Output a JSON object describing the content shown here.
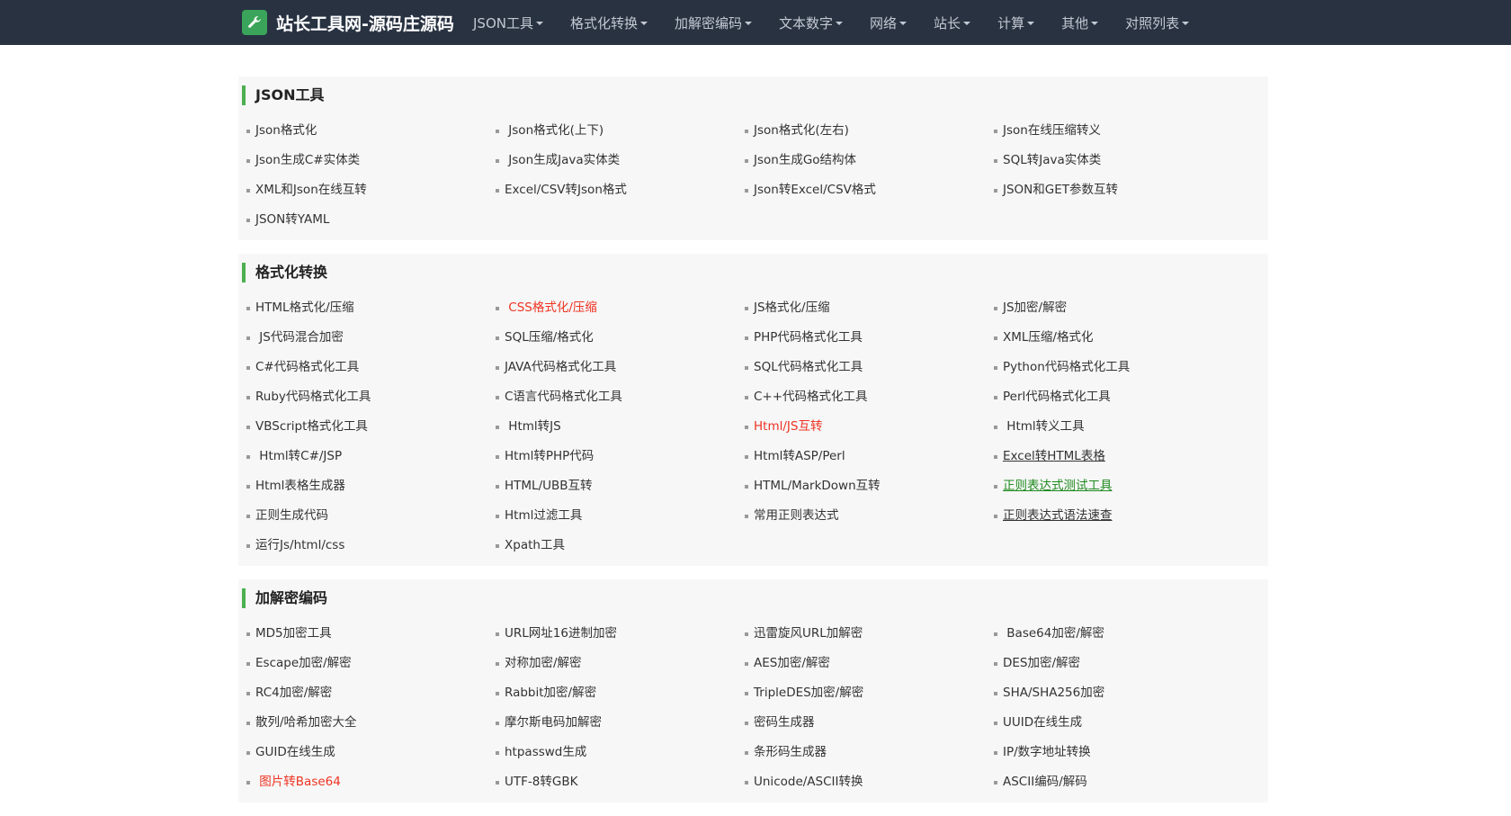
{
  "header": {
    "brand": "站长工具网-源码庄源码",
    "logo_icon": "wrench-icon",
    "menu": [
      {
        "label": "JSON工具"
      },
      {
        "label": "格式化转换"
      },
      {
        "label": "加解密编码"
      },
      {
        "label": "文本数字"
      },
      {
        "label": "网络"
      },
      {
        "label": "站长"
      },
      {
        "label": "计算"
      },
      {
        "label": "其他"
      },
      {
        "label": "对照列表"
      }
    ]
  },
  "colors": {
    "navbar": "#283241",
    "accent": "#4cb050",
    "highlight_red": "#ee3322",
    "highlight_green": "#1f8a1f"
  },
  "sections": [
    {
      "title": "JSON工具",
      "links": [
        {
          "label": "Json格式化"
        },
        {
          "label": " Json格式化(上下)"
        },
        {
          "label": "Json格式化(左右)"
        },
        {
          "label": "Json在线压缩转义"
        },
        {
          "label": "Json生成C#实体类"
        },
        {
          "label": " Json生成Java实体类"
        },
        {
          "label": "Json生成Go结构体"
        },
        {
          "label": "SQL转Java实体类"
        },
        {
          "label": "XML和Json在线互转"
        },
        {
          "label": "Excel/CSV转Json格式"
        },
        {
          "label": "Json转Excel/CSV格式"
        },
        {
          "label": "JSON和GET参数互转"
        },
        {
          "label": "JSON转YAML"
        }
      ]
    },
    {
      "title": "格式化转换",
      "links": [
        {
          "label": "HTML格式化/压缩"
        },
        {
          "label": " CSS格式化/压缩",
          "style": "red"
        },
        {
          "label": "JS格式化/压缩"
        },
        {
          "label": "JS加密/解密"
        },
        {
          "label": " JS代码混合加密"
        },
        {
          "label": "SQL压缩/格式化"
        },
        {
          "label": "PHP代码格式化工具"
        },
        {
          "label": "XML压缩/格式化"
        },
        {
          "label": "C#代码格式化工具"
        },
        {
          "label": "JAVA代码格式化工具"
        },
        {
          "label": "SQL代码格式化工具"
        },
        {
          "label": "Python代码格式化工具"
        },
        {
          "label": "Ruby代码格式化工具"
        },
        {
          "label": "C语言代码格式化工具"
        },
        {
          "label": "C++代码格式化工具"
        },
        {
          "label": "Perl代码格式化工具"
        },
        {
          "label": "VBScript格式化工具"
        },
        {
          "label": " Html转JS"
        },
        {
          "label": "Html/JS互转",
          "style": "red"
        },
        {
          "label": " Html转义工具"
        },
        {
          "label": " Html转C#/JSP"
        },
        {
          "label": "Html转PHP代码"
        },
        {
          "label": "Html转ASP/Perl"
        },
        {
          "label": "Excel转HTML表格",
          "style": "underline"
        },
        {
          "label": "Html表格生成器"
        },
        {
          "label": "HTML/UBB互转"
        },
        {
          "label": "HTML/MarkDown互转"
        },
        {
          "label": "正则表达式测试工具",
          "style": "green"
        },
        {
          "label": "正则生成代码"
        },
        {
          "label": "Html过滤工具"
        },
        {
          "label": "常用正则表达式"
        },
        {
          "label": "正则表达式语法速查",
          "style": "underline"
        },
        {
          "label": "运行Js/html/css"
        },
        {
          "label": "Xpath工具"
        }
      ]
    },
    {
      "title": "加解密编码",
      "links": [
        {
          "label": "MD5加密工具"
        },
        {
          "label": "URL网址16进制加密"
        },
        {
          "label": "迅雷旋风URL加解密"
        },
        {
          "label": " Base64加密/解密"
        },
        {
          "label": "Escape加密/解密"
        },
        {
          "label": "对称加密/解密"
        },
        {
          "label": "AES加密/解密"
        },
        {
          "label": "DES加密/解密"
        },
        {
          "label": "RC4加密/解密"
        },
        {
          "label": "Rabbit加密/解密"
        },
        {
          "label": "TripleDES加密/解密"
        },
        {
          "label": "SHA/SHA256加密"
        },
        {
          "label": "散列/哈希加密大全"
        },
        {
          "label": "摩尔斯电码加解密"
        },
        {
          "label": "密码生成器"
        },
        {
          "label": "UUID在线生成"
        },
        {
          "label": "GUID在线生成"
        },
        {
          "label": "htpasswd生成"
        },
        {
          "label": "条形码生成器"
        },
        {
          "label": "IP/数字地址转换"
        },
        {
          "label": " 图片转Base64",
          "style": "red"
        },
        {
          "label": "UTF-8转GBK"
        },
        {
          "label": "Unicode/ASCII转换"
        },
        {
          "label": "ASCII编码/解码"
        }
      ]
    }
  ]
}
